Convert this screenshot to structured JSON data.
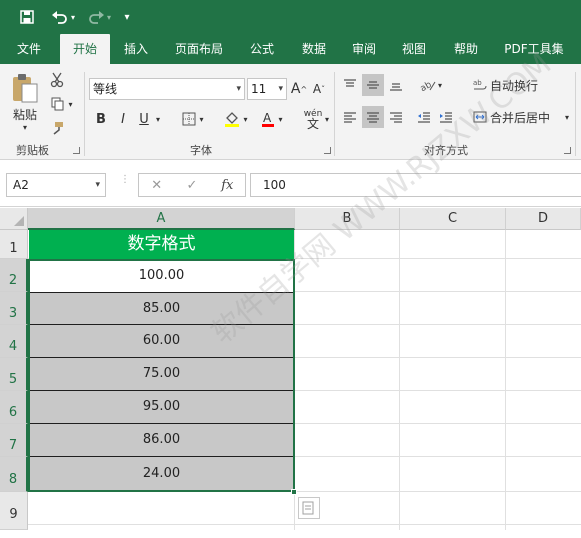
{
  "quick_access": {
    "save_icon": "save-icon",
    "undo_icon": "undo-icon",
    "redo_icon": "redo-icon",
    "customize_icon": "customize-qat-icon"
  },
  "tabs": [
    "文件",
    "开始",
    "插入",
    "页面布局",
    "公式",
    "数据",
    "审阅",
    "视图",
    "帮助",
    "PDF工具集"
  ],
  "active_tab": "开始",
  "ribbon": {
    "paste_label": "粘贴",
    "clipboard_group": "剪贴板",
    "font_name": "等线",
    "font_size": "11",
    "font_group": "字体",
    "bold": "B",
    "italic": "I",
    "underline": "U",
    "wrap_text": "自动换行",
    "merge_center": "合并后居中",
    "alignment_group": "对齐方式",
    "font_color": "#ff0000",
    "fill_color": "#ffff00"
  },
  "formula_bar": {
    "name_box": "A2",
    "cancel": "✕",
    "enter": "✓",
    "fx": "fx",
    "formula": "100"
  },
  "sheet": {
    "columns": [
      "A",
      "B",
      "C",
      "D"
    ],
    "rows": [
      "1",
      "2",
      "3",
      "4",
      "5",
      "6",
      "7",
      "8",
      "9"
    ],
    "header_cell": "数字格式",
    "values": [
      "100.00",
      "85.00",
      "60.00",
      "75.00",
      "95.00",
      "86.00",
      "24.00"
    ],
    "header_color": "#00b050",
    "selection_color": "#217346"
  },
  "watermark": "软件自学网 WWW.RJZXW.COM"
}
